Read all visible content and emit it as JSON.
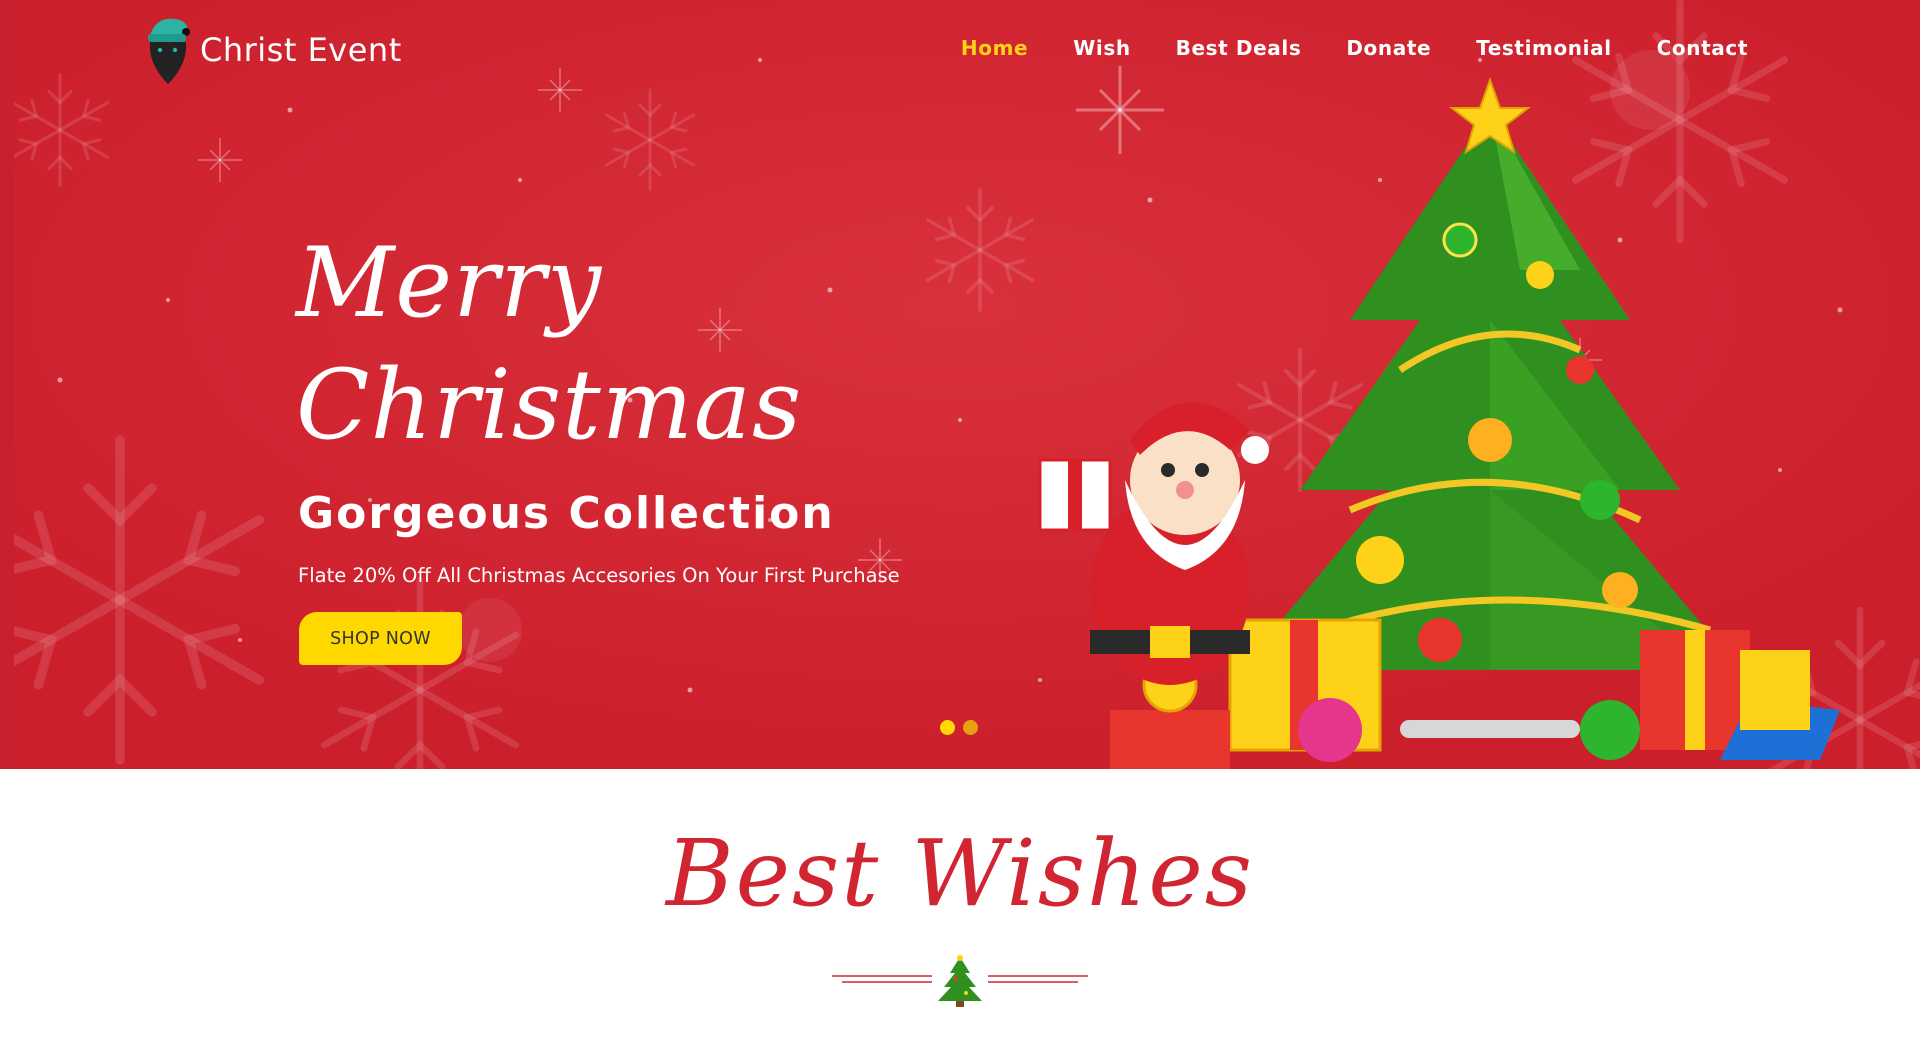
{
  "colors": {
    "hero_red": "#d12532",
    "accent_yellow": "#ffd800",
    "nav_active": "#ffd21a",
    "white": "#ffffff",
    "title_red": "#d12532"
  },
  "header": {
    "logo_text": "Christ Event",
    "logo_icon": "santa-logo-icon",
    "nav": [
      {
        "label": "Home",
        "active": true
      },
      {
        "label": "Wish",
        "active": false
      },
      {
        "label": "Best Deals",
        "active": false
      },
      {
        "label": "Donate",
        "active": false
      },
      {
        "label": "Testimonial",
        "active": false
      },
      {
        "label": "Contact",
        "active": false
      }
    ]
  },
  "hero": {
    "script_line1": "Merry",
    "script_line2": "Christmas",
    "heading": "Gorgeous Collection",
    "subtext": "Flate 20% Off All Christmas Accesories On Your First Purchase",
    "cta_label": "SHOP NOW",
    "slider_dots": 2,
    "active_slide": 1,
    "illustration": "santa-and-christmas-tree-illustration"
  },
  "wishes": {
    "title": "Best Wishes",
    "divider_icon": "christmas-tree-icon"
  }
}
